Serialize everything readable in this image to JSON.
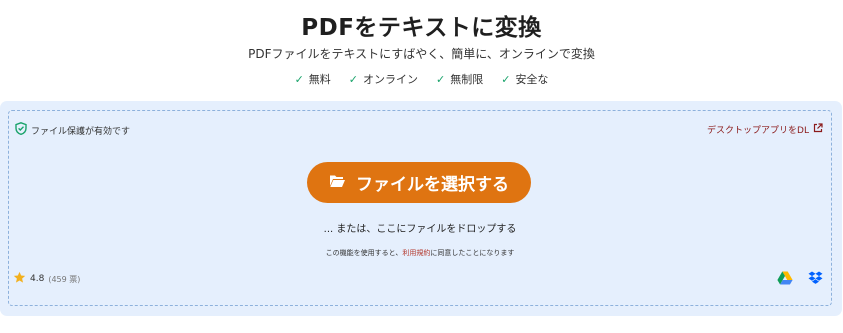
{
  "header": {
    "title": "PDFをテキストに変換",
    "subtitle": "PDFファイルをテキストにすばやく、簡単に、オンラインで変換",
    "features": [
      "無料",
      "オンライン",
      "無制限",
      "安全な"
    ]
  },
  "dropzone": {
    "protection_label": "ファイル保護が有効です",
    "desktop_link": "デスクトップアプリをDL",
    "select_button": "ファイルを選択する",
    "or_drop": "... または、ここにファイルをドロップする",
    "terms_prefix": "この機能を使用すると、",
    "terms_link": "利用規約",
    "terms_suffix": "に同意したことになります",
    "rating": "4.8",
    "votes": "(459 票)"
  },
  "colors": {
    "accent": "#df7411",
    "panel_bg": "#e5effd",
    "check": "#1aa36b",
    "link": "#8b1a1a"
  },
  "icons": {
    "protection": "shield-check-icon",
    "desktop": "external-link-icon",
    "select": "folder-open-icon",
    "rating": "star-icon",
    "cloud1": "google-drive-icon",
    "cloud2": "dropbox-icon"
  }
}
